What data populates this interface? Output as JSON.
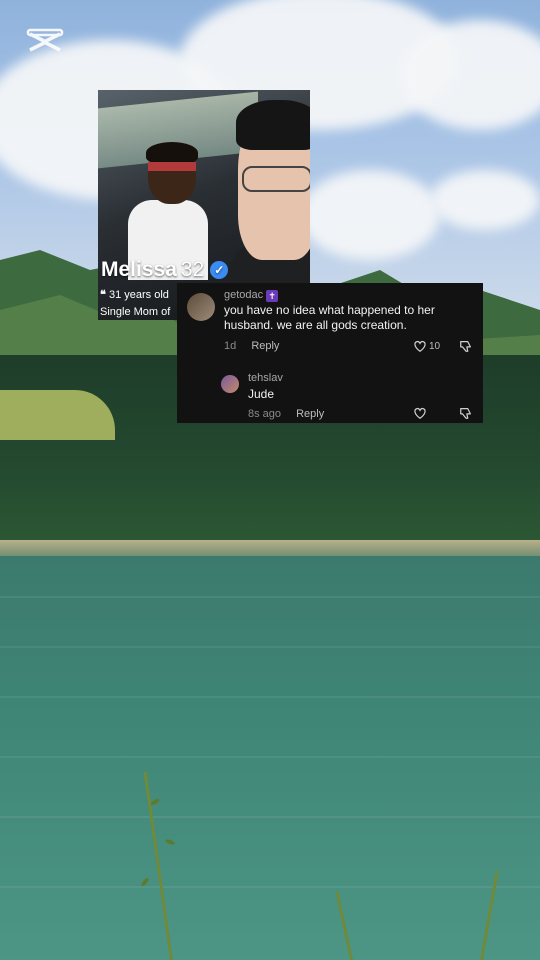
{
  "overlay": {
    "profile": {
      "name": "Melissa",
      "age": "32",
      "line1": "31 years old",
      "line2": "Single Mom of"
    },
    "comment": {
      "username": "getodac",
      "text": "you have no idea what happened to her husband. we are all gods creation.",
      "time": "1d",
      "reply_label": "Reply",
      "likes": "10"
    },
    "reply": {
      "username": "tehslav",
      "text": "Jude",
      "time": "8s ago",
      "reply_label": "Reply"
    }
  },
  "colors": {
    "verified": "#3b8bf2",
    "comment_bg": "#121212",
    "lake": "#3f8676"
  },
  "icons": [
    "capcut-logo-icon",
    "verified-icon",
    "quote-icon",
    "heart-icon",
    "dislike-icon"
  ]
}
